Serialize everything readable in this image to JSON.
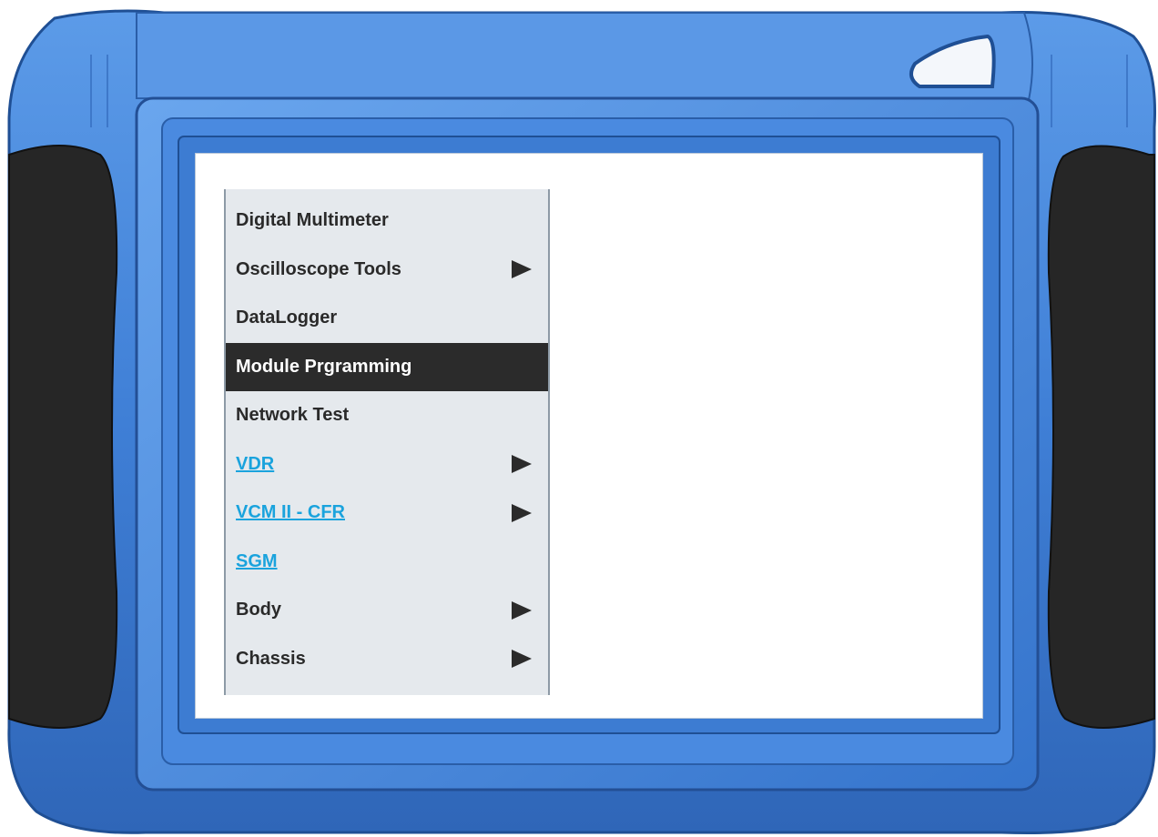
{
  "device": {
    "frame_color": "#3f7fd6",
    "grip_color": "#262626"
  },
  "menu": {
    "items": [
      {
        "label": "Digital Multimeter",
        "has_submenu": false,
        "style": "normal",
        "selected": false
      },
      {
        "label": "Oscilloscope Tools",
        "has_submenu": true,
        "style": "normal",
        "selected": false
      },
      {
        "label": "DataLogger",
        "has_submenu": false,
        "style": "normal",
        "selected": false
      },
      {
        "label": "Module Prgramming",
        "has_submenu": false,
        "style": "normal",
        "selected": true
      },
      {
        "label": "Network Test",
        "has_submenu": false,
        "style": "normal",
        "selected": false
      },
      {
        "label": "VDR",
        "has_submenu": true,
        "style": "link",
        "selected": false
      },
      {
        "label": "VCM II - CFR",
        "has_submenu": true,
        "style": "link",
        "selected": false
      },
      {
        "label": "SGM",
        "has_submenu": false,
        "style": "link",
        "selected": false
      },
      {
        "label": "Body",
        "has_submenu": true,
        "style": "normal",
        "selected": false
      },
      {
        "label": "Chassis",
        "has_submenu": true,
        "style": "normal",
        "selected": false
      }
    ],
    "link_color": "#1aa3dd",
    "selected_bg": "#2b2b2b",
    "arrow_icon": "triangle-right-icon"
  }
}
